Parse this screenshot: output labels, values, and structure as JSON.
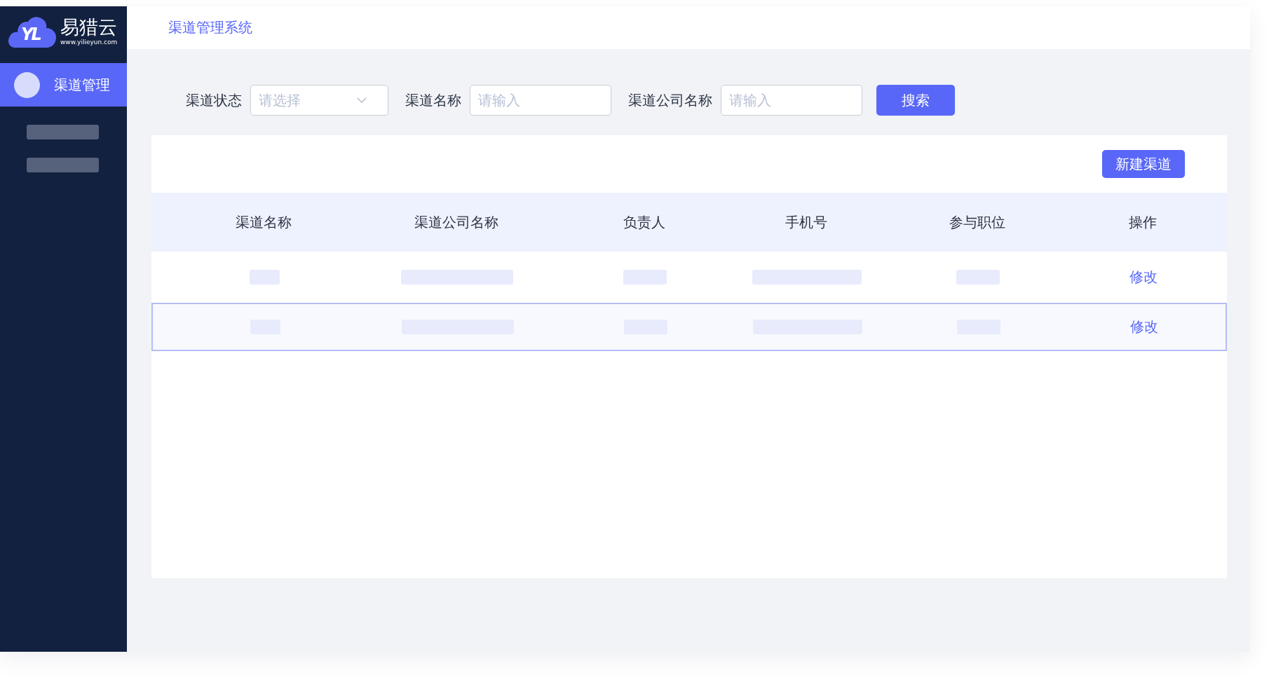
{
  "sidebar": {
    "logo": {
      "mark": "YL",
      "name": "易猎云",
      "url": "www.yilieyun.com"
    },
    "items": [
      {
        "label": "渠道管理",
        "selected": true
      }
    ]
  },
  "header": {
    "title": "渠道管理系统"
  },
  "filters": [
    {
      "kind": "select",
      "label": "渠道状态",
      "placeholder": "请选择"
    },
    {
      "kind": "input",
      "label": "渠道名称",
      "placeholder": "请输入"
    },
    {
      "kind": "input",
      "label": "渠道公司名称",
      "placeholder": "请输入"
    }
  ],
  "search_button": "搜索",
  "table": {
    "new_button": "新建渠道",
    "columns": [
      "渠道名称",
      "渠道公司名称",
      "负责人",
      "手机号",
      "参与职位",
      "操作"
    ],
    "rows": [
      {
        "selected": false,
        "action": "修改"
      },
      {
        "selected": true,
        "action": "修改"
      }
    ]
  }
}
